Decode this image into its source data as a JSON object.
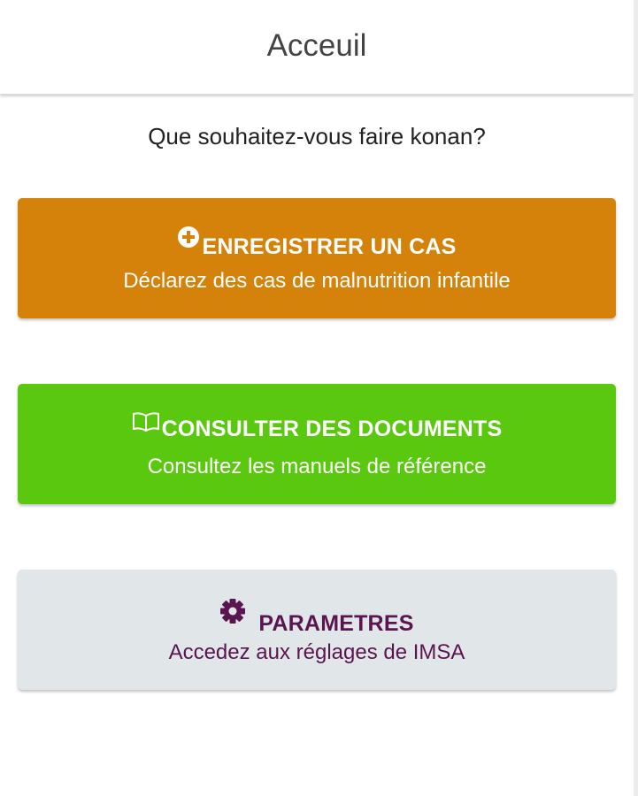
{
  "header": {
    "title": "Acceuil"
  },
  "prompt": "Que souhaitez-vous faire konan?",
  "actions": [
    {
      "title": "ENREGISTRER UN CAS",
      "subtitle": "Déclarez des cas de malnutrition infantile",
      "icon": "plus-circle-icon",
      "color": "#d4820a",
      "text_color": "#ffffff"
    },
    {
      "title": "CONSULTER DES DOCUMENTS",
      "subtitle": "Consultez les manuels de référence",
      "icon": "book-open-icon",
      "color": "#5bc810",
      "text_color": "#ffffff"
    },
    {
      "title": "PARAMETRES",
      "subtitle": "Accedez aux réglages de IMSA",
      "icon": "gear-icon",
      "color": "#e1e7e8",
      "text_color": "#5a1550"
    }
  ]
}
